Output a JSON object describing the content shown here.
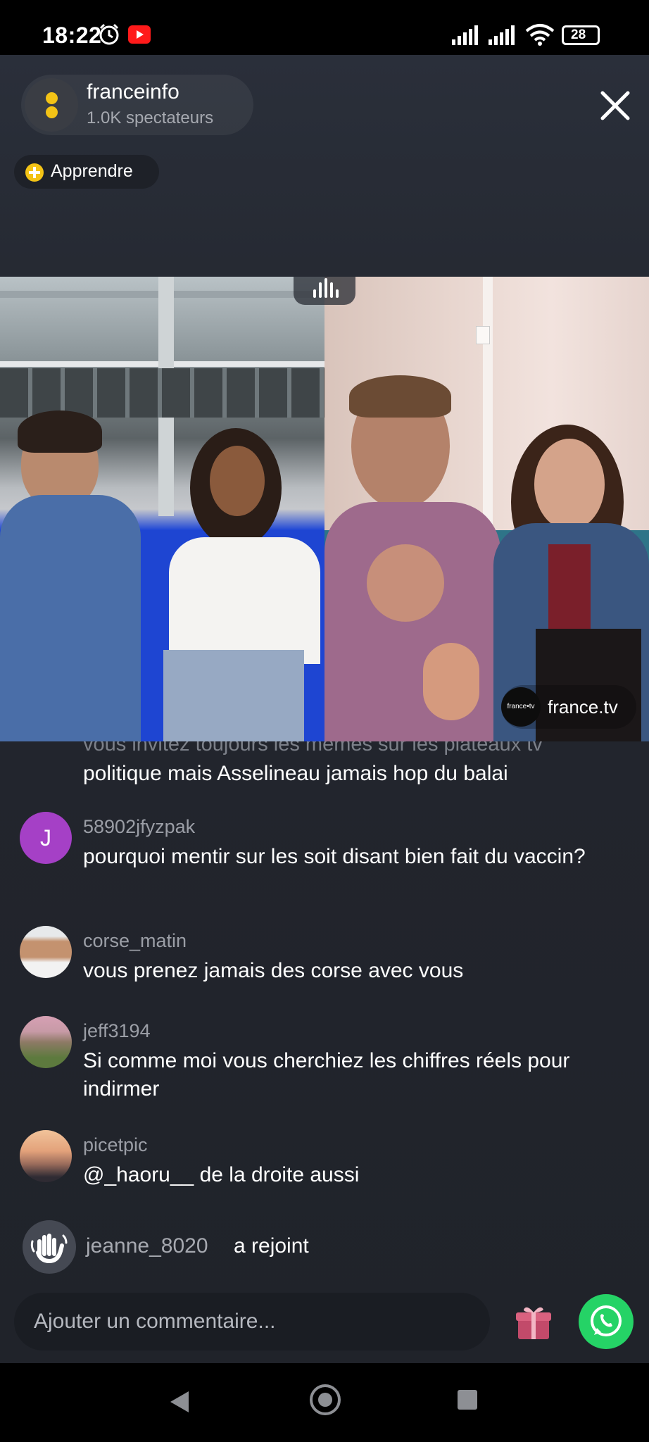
{
  "status_bar": {
    "time": "18:22",
    "battery": "28"
  },
  "header": {
    "channel_name": "franceinfo",
    "viewers": "1.0K spectateurs",
    "learn_label": "Apprendre"
  },
  "video": {
    "watermark_logo": "france•tv",
    "watermark_name": "france.tv"
  },
  "comments": {
    "cut_line": "vous invitez toujours les mêmes sur les plateaux tv",
    "cut_text": "politique mais Asselineau jamais hop du balai",
    "items": [
      {
        "user": "58902jfyzpak",
        "avatar_letter": "J",
        "text": "pourquoi mentir sur les soit disant bien fait du vaccin?"
      },
      {
        "user": "corse_matin",
        "text": "vous prenez jamais des corse avec vous"
      },
      {
        "user": "jeff3194",
        "text": "Si comme moi vous cherchiez les chiffres réels pour indirmer"
      },
      {
        "user": "picetpic",
        "text": "@_haoru__ de la droite aussi"
      }
    ]
  },
  "join": {
    "user": "jeanne_8020",
    "text": "a rejoint"
  },
  "input": {
    "placeholder": "Ajouter un commentaire..."
  },
  "colors": {
    "accent_yellow": "#f3c316",
    "whatsapp_green": "#25d366",
    "avatar_purple": "#a540c6"
  }
}
